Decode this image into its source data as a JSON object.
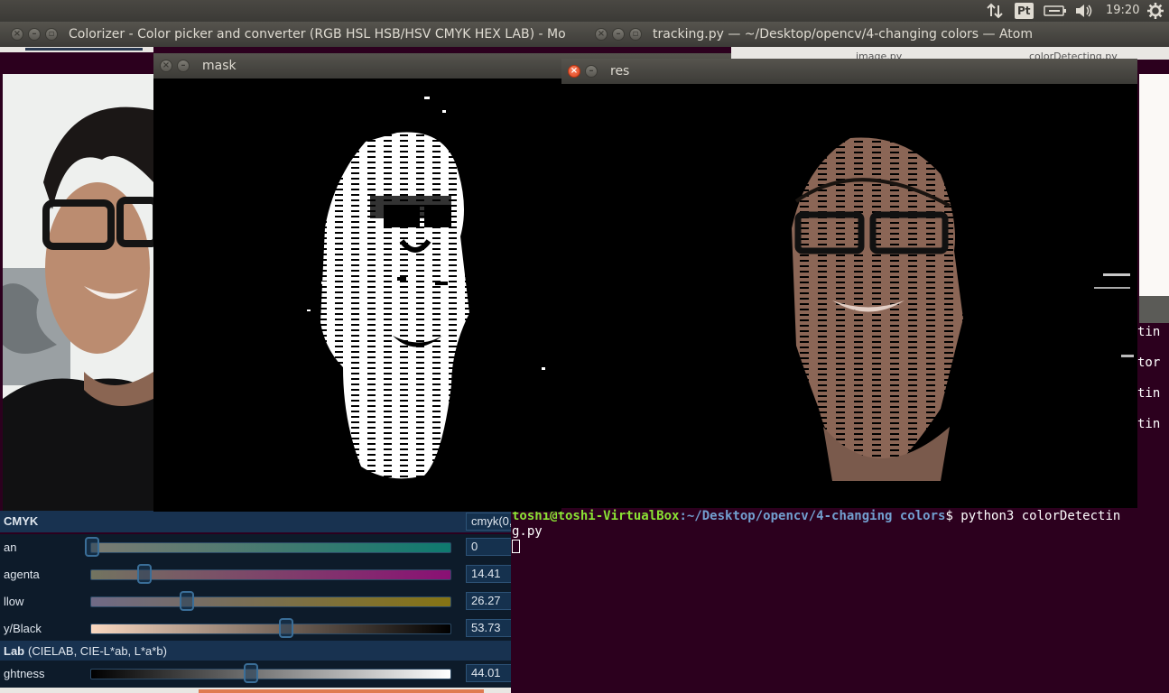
{
  "top_panel": {
    "time": "19:20",
    "keyboard_indicator": "Pt",
    "icons": [
      "network-arrows-icon",
      "keyboard-indicator-icon",
      "battery-icon",
      "volume-icon",
      "settings-gear-icon"
    ]
  },
  "windows": {
    "colorizer": {
      "title": "Colorizer - Color picker and converter (RGB HSL HSB/HSV CMYK HEX LAB) - Mo",
      "cmyk_section": {
        "heading": "CMYK",
        "css_value": "cmyk(0,",
        "sliders": [
          {
            "label": "an",
            "value": "0",
            "position": 0.0
          },
          {
            "label": "agenta",
            "value": "14.41",
            "position": 0.1441
          },
          {
            "label": "llow",
            "value": "26.27",
            "position": 0.2627
          },
          {
            "label": "y/Black",
            "value": "53.73",
            "position": 0.5373
          }
        ]
      },
      "lab_section": {
        "heading": "Lab",
        "subheading": "(CIELAB, CIE-L*ab, L*a*b)",
        "sliders": [
          {
            "label": "ghtness",
            "value": "44.01",
            "position": 0.4401
          }
        ]
      }
    },
    "atom": {
      "title": "tracking.py — ~/Desktop/opencv/4-changing colors — Atom",
      "tabs": [
        "image.py",
        "colorDetecting.py"
      ]
    },
    "mask": {
      "title": "mask"
    },
    "res": {
      "title": "res"
    },
    "terminal": {
      "line_fragments": [
        "tin",
        "tor",
        "tin",
        "tin"
      ],
      "prompt_user": "toshi@toshi-VirtualBox",
      "prompt_path": ":~/Desktop/opencv/4-changing colors",
      "command": "$ python3 colorDetectin",
      "command_wrap": "g.py"
    }
  }
}
